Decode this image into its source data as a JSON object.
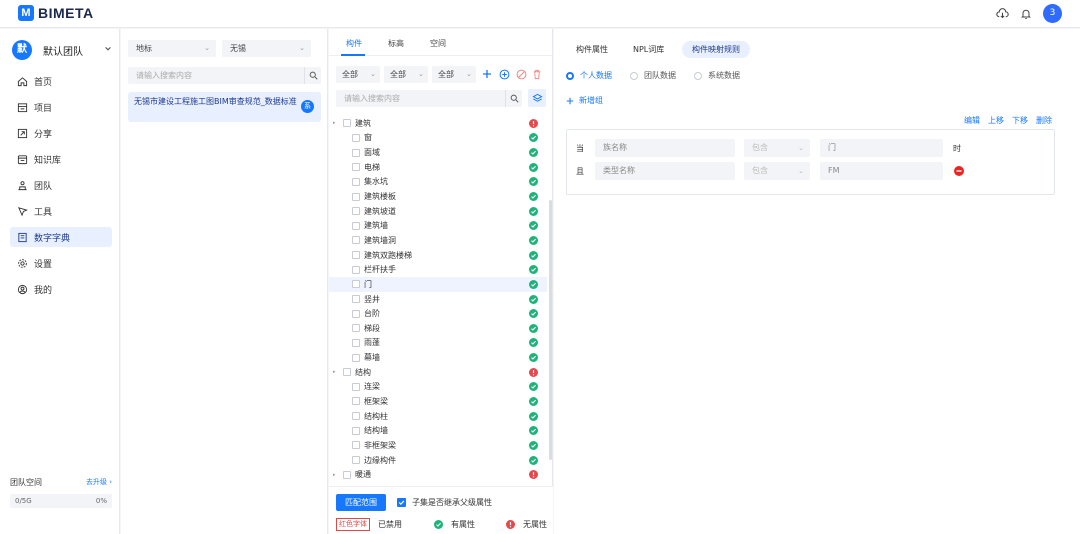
{
  "app": {
    "logo_letter": "M",
    "logo_text": "BIMETA",
    "user_avatar": "3",
    "icons": [
      "cloud-download-icon",
      "bell-icon"
    ]
  },
  "sidebar": {
    "team_avatar": "默",
    "team_name": "默认团队",
    "items": [
      {
        "label": "首页",
        "icon": "home-icon"
      },
      {
        "label": "项目",
        "icon": "project-icon"
      },
      {
        "label": "分享",
        "icon": "share-icon"
      },
      {
        "label": "知识库",
        "icon": "knowledge-icon"
      },
      {
        "label": "团队",
        "icon": "team-icon"
      },
      {
        "label": "工具",
        "icon": "tool-icon"
      },
      {
        "label": "数字字典",
        "icon": "dictionary-icon",
        "active": true
      },
      {
        "label": "设置",
        "icon": "gear-icon"
      },
      {
        "label": "我的",
        "icon": "user-icon"
      }
    ],
    "space": {
      "title": "团队空间",
      "upgrade": "去升级",
      "usage": "0/5G",
      "percent": "0%"
    }
  },
  "standards": {
    "filter1": "地标",
    "filter2": "无锡",
    "search_placeholder": "请输入搜索内容",
    "item_title": "无锡市建设工程施工图BIM审查规范_数据标准",
    "item_badge": "系"
  },
  "components": {
    "tabs": [
      "构件",
      "标高",
      "空间"
    ],
    "filters": [
      "全部",
      "全部",
      "全部"
    ],
    "search_placeholder": "请输入搜索内容",
    "tree": [
      {
        "label": "建筑",
        "level": 0,
        "status": "error"
      },
      {
        "label": "窗",
        "level": 1,
        "status": "ok"
      },
      {
        "label": "面域",
        "level": 1,
        "status": "ok"
      },
      {
        "label": "电梯",
        "level": 1,
        "status": "ok"
      },
      {
        "label": "集水坑",
        "level": 1,
        "status": "ok"
      },
      {
        "label": "建筑楼板",
        "level": 1,
        "status": "ok"
      },
      {
        "label": "建筑坡道",
        "level": 1,
        "status": "ok"
      },
      {
        "label": "建筑墙",
        "level": 1,
        "status": "ok"
      },
      {
        "label": "建筑墙洞",
        "level": 1,
        "status": "ok"
      },
      {
        "label": "建筑双跑楼梯",
        "level": 1,
        "status": "ok"
      },
      {
        "label": "栏杆扶手",
        "level": 1,
        "status": "ok"
      },
      {
        "label": "门",
        "level": 1,
        "status": "ok",
        "selected": true
      },
      {
        "label": "竖井",
        "level": 1,
        "status": "ok"
      },
      {
        "label": "台阶",
        "level": 1,
        "status": "ok"
      },
      {
        "label": "梯段",
        "level": 1,
        "status": "ok"
      },
      {
        "label": "雨蓬",
        "level": 1,
        "status": "ok"
      },
      {
        "label": "幕墙",
        "level": 1,
        "status": "ok"
      },
      {
        "label": "结构",
        "level": 0,
        "status": "error"
      },
      {
        "label": "连梁",
        "level": 1,
        "status": "ok"
      },
      {
        "label": "框架梁",
        "level": 1,
        "status": "ok"
      },
      {
        "label": "结构柱",
        "level": 1,
        "status": "ok"
      },
      {
        "label": "结构墙",
        "level": 1,
        "status": "ok"
      },
      {
        "label": "非框架梁",
        "level": 1,
        "status": "ok"
      },
      {
        "label": "边缘构件",
        "level": 1,
        "status": "ok"
      },
      {
        "label": "暖通",
        "level": 0,
        "status": "error"
      }
    ],
    "match_button": "匹配范围",
    "inherit_label": "子集是否继承父级属性",
    "legend": {
      "red_font": "红色字体",
      "disabled": "已禁用",
      "has_attr": "有属性",
      "no_attr": "无属性"
    }
  },
  "rules": {
    "tabs": [
      "构件属性",
      "NPL词库",
      "构件映射规则"
    ],
    "radios": [
      "个人数据",
      "团队数据",
      "系统数据"
    ],
    "add_group": "新增组",
    "actions": [
      "编辑",
      "上移",
      "下移",
      "删除"
    ],
    "rows": [
      {
        "prefix": "当",
        "field": "族名称",
        "op": "包含",
        "value": "门",
        "suffix": "时"
      },
      {
        "prefix": "且",
        "field": "类型名称",
        "op": "包含",
        "value": "FM",
        "suffix": ""
      }
    ]
  },
  "colors": {
    "accent": "#1677ff",
    "ok": "#1db37a",
    "error": "#e5484d"
  }
}
